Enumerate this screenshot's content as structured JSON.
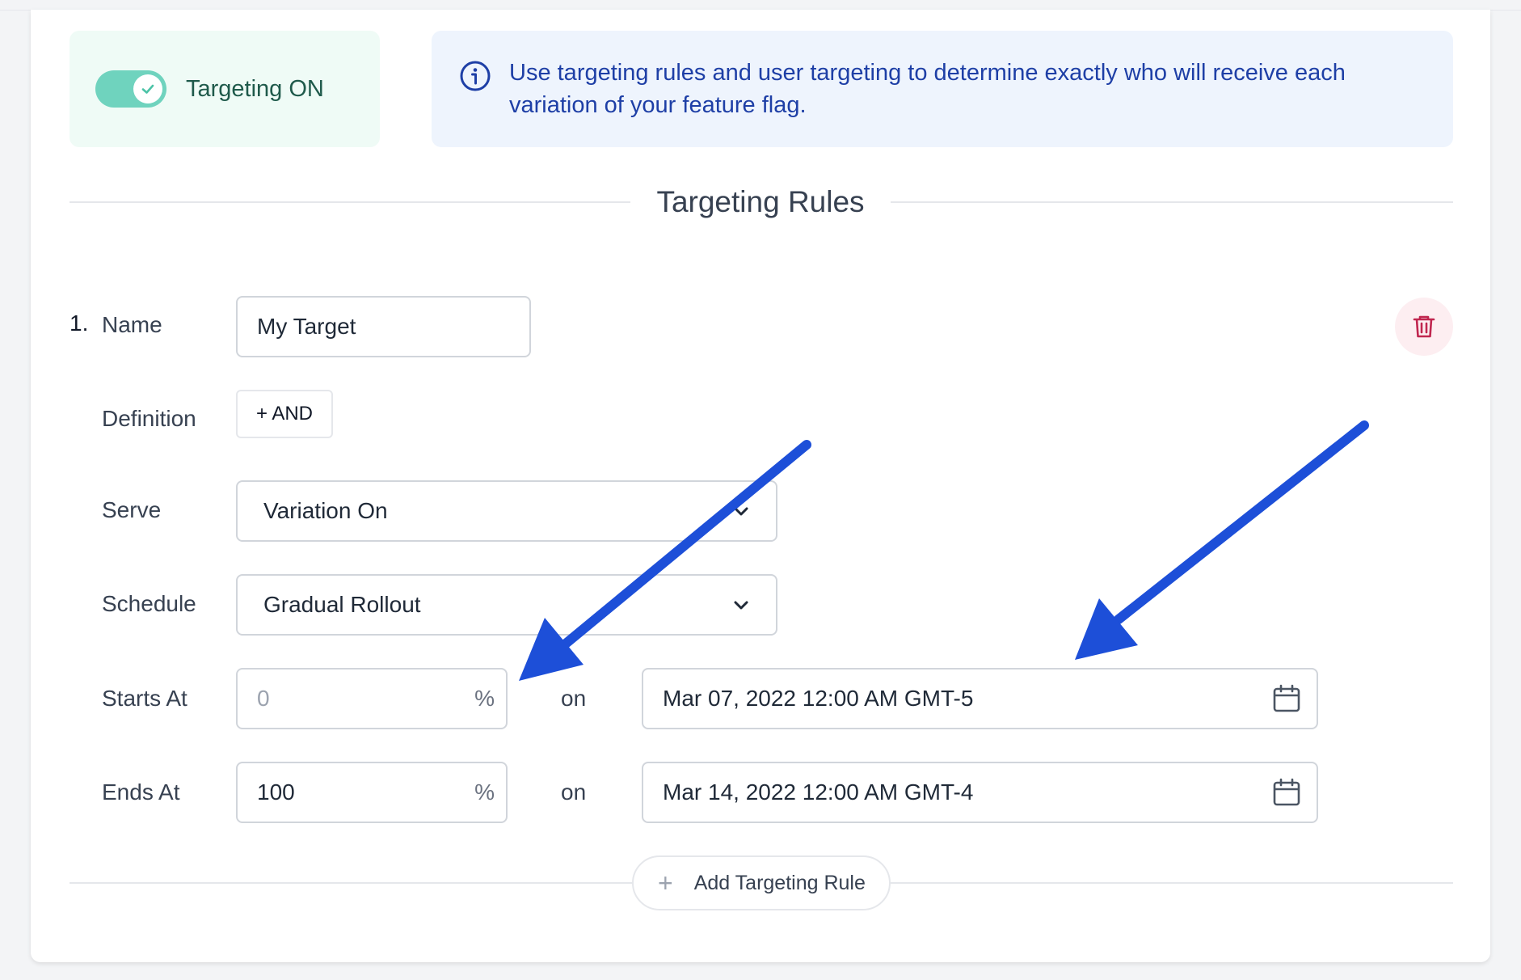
{
  "targeting_toggle": {
    "label": "Targeting ON",
    "state": "on",
    "accent_color": "#6fd3be"
  },
  "info_banner": {
    "icon": "info-icon",
    "text": "Use targeting rules and user targeting to determine exactly who will receive each variation of your feature flag."
  },
  "section": {
    "title": "Targeting Rules"
  },
  "rule": {
    "number": "1.",
    "name_label": "Name",
    "name_value": "My Target",
    "definition_label": "Definition",
    "and_button": "+ AND",
    "serve_label": "Serve",
    "serve_value": "Variation On",
    "schedule_label": "Schedule",
    "schedule_value": "Gradual Rollout",
    "starts_label": "Starts At",
    "starts_percent_placeholder": "0",
    "starts_on": "on",
    "starts_date": "Mar 07, 2022 12:00 AM GMT-5",
    "ends_label": "Ends At",
    "ends_percent": "100",
    "ends_on": "on",
    "ends_date": "Mar 14, 2022 12:00 AM GMT-4",
    "percent_symbol": "%",
    "delete_icon": "trash-icon"
  },
  "add_rule_button": {
    "plus": "+",
    "label": "Add Targeting Rule"
  },
  "annotation_color": "#1d4fd8"
}
